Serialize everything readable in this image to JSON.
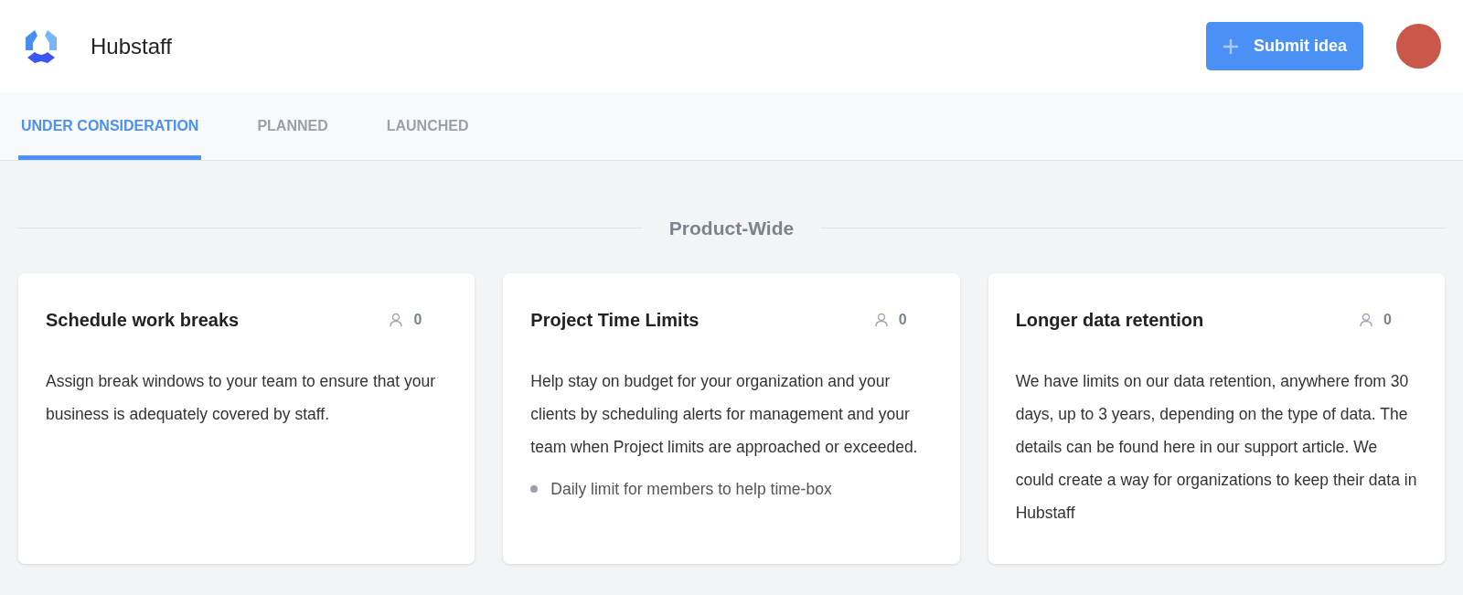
{
  "header": {
    "brand": "Hubstaff",
    "submit_button": "Submit idea"
  },
  "tabs": [
    {
      "label": "UNDER CONSIDERATION",
      "selected": true
    },
    {
      "label": "PLANNED",
      "selected": false
    },
    {
      "label": "LAUNCHED",
      "selected": false
    }
  ],
  "section": {
    "title": "Product-Wide"
  },
  "cards": [
    {
      "title": "Schedule work breaks",
      "votes": "0",
      "description": "Assign break windows to your team to ensure that your business is adequately covered by staff."
    },
    {
      "title": "Project Time Limits",
      "votes": "0",
      "description": "Help stay on budget for your organization and your clients by scheduling alerts for management and your team when Project limits are approached or exceeded.",
      "bullets": [
        "Daily limit for members to help time-box"
      ]
    },
    {
      "title": "Longer data retention",
      "votes": "0",
      "description": "We have limits on our data retention, anywhere from 30 days, up to 3 years, depending on the type of data. The details can be found here in our support article. We could create a way for organizations to keep their data in Hubstaff"
    }
  ]
}
